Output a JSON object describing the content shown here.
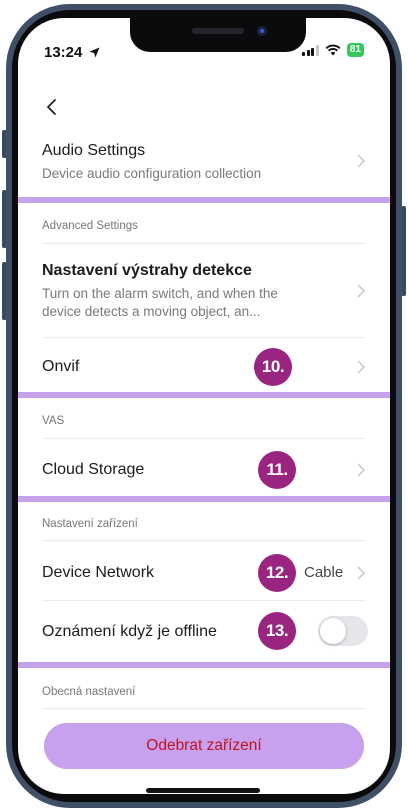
{
  "status_bar": {
    "time": "13:24",
    "battery": "81"
  },
  "audio": {
    "title": "Audio Settings",
    "subtitle": "Device audio configuration collection"
  },
  "sections": {
    "advanced": "Advanced Settings",
    "vas": "VAS",
    "device_settings": "Nastavení zařízení",
    "general": "Obecná nastavení"
  },
  "detection": {
    "title": "Nastavení výstrahy detekce",
    "subtitle": "Turn on the alarm switch, and when the device detects a moving object, an..."
  },
  "onvif": {
    "title": "Onvif",
    "badge": "10."
  },
  "cloud": {
    "title": "Cloud Storage",
    "badge": "11."
  },
  "network": {
    "title": "Device Network",
    "badge": "12.",
    "value": "Cable"
  },
  "offline": {
    "title": "Oznámení když je offline",
    "badge": "13.",
    "enabled": false
  },
  "remove_button": "Odebrat zařízení",
  "colors": {
    "accent": "#c6a2ec",
    "badge": "#9a2580",
    "danger": "#c1121f"
  }
}
